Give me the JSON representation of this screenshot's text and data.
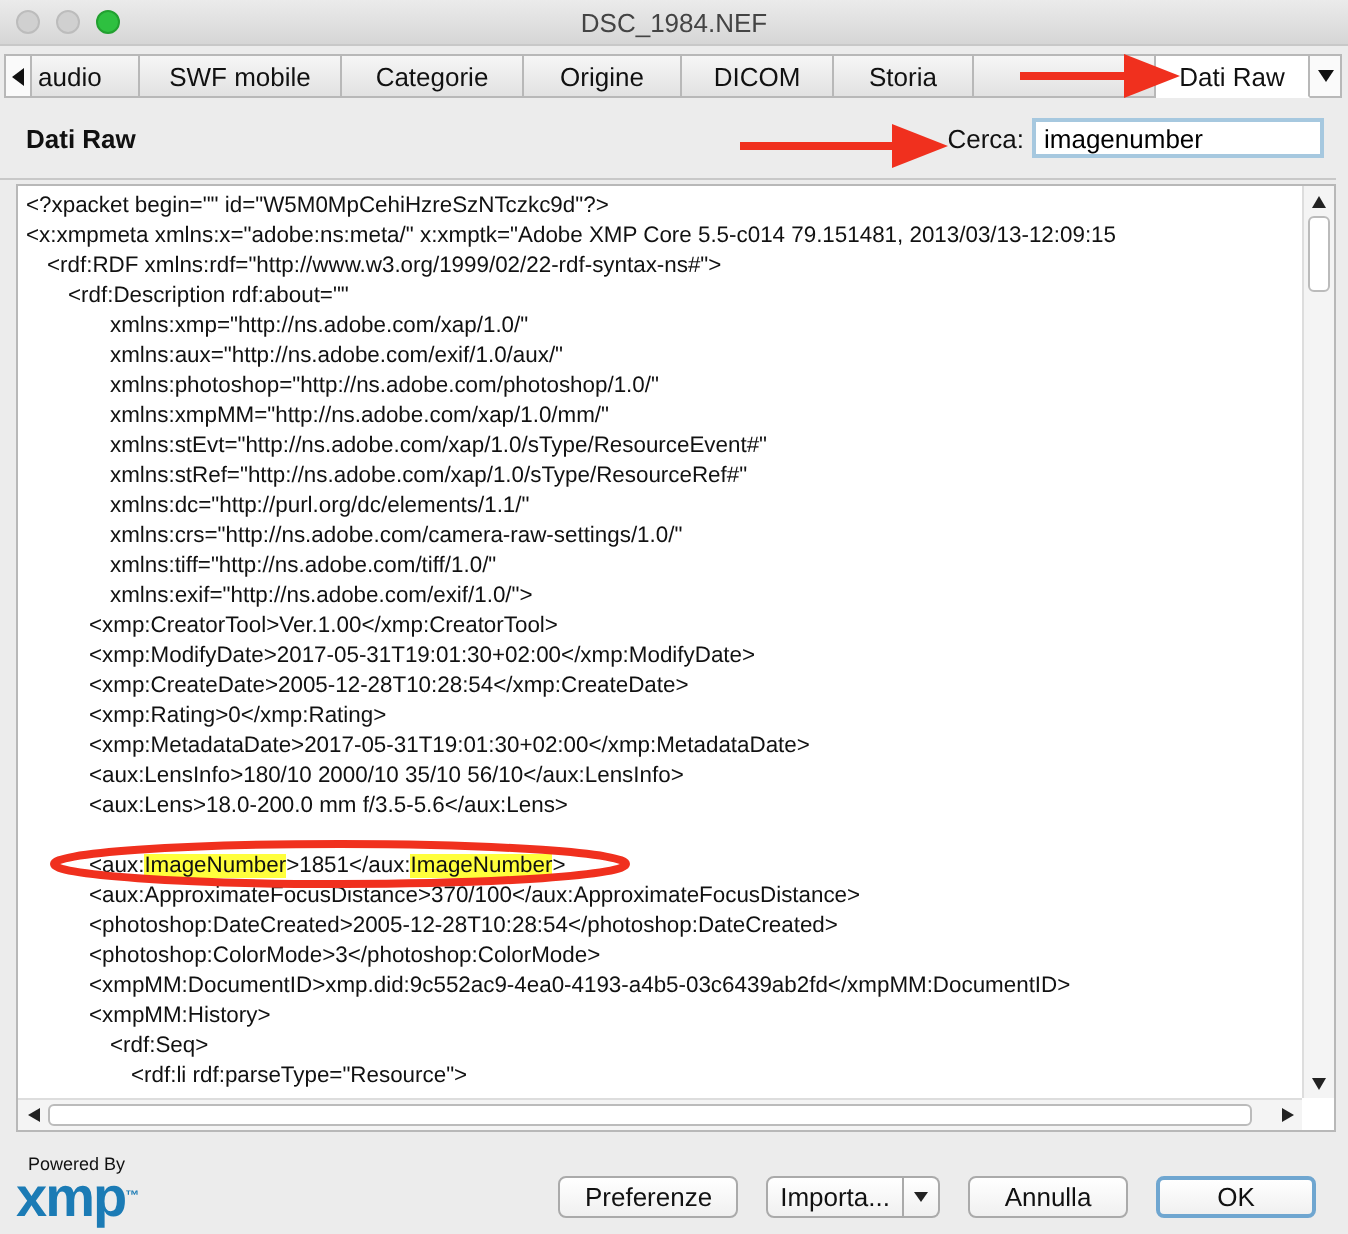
{
  "window": {
    "title": "DSC_1984.NEF"
  },
  "tabs": [
    {
      "label": "audio",
      "selected": false
    },
    {
      "label": "SWF mobile",
      "selected": false
    },
    {
      "label": "Categorie",
      "selected": false
    },
    {
      "label": "Origine",
      "selected": false
    },
    {
      "label": "DICOM",
      "selected": false
    },
    {
      "label": "Storia",
      "selected": false
    },
    {
      "selected": false
    },
    {
      "label": "Dati Raw",
      "selected": true
    }
  ],
  "panel": {
    "title": "Dati Raw",
    "search": {
      "label": "Cerca:",
      "value": "imagenumber"
    }
  },
  "xml": [
    {
      "text": "<?xpacket begin=\"\" id=\"W5M0MpCehiHzreSzNTczkc9d\"?>"
    },
    {
      "text": "<x:xmpmeta xmlns:x=\"adobe:ns:meta/\" x:xmptk=\"Adobe XMP Core 5.5-c014 79.151481, 2013/03/13-12:09:15",
      "children": [
        {
          "text": "<rdf:RDF xmlns:rdf=\"http://www.w3.org/1999/02/22-rdf-syntax-ns#\">",
          "children": [
            {
              "text": "<rdf:Description rdf:about=\"\"",
              "attributes": [
                "xmlns:xmp=\"http://ns.adobe.com/xap/1.0/\"",
                "xmlns:aux=\"http://ns.adobe.com/exif/1.0/aux/\"",
                "xmlns:photoshop=\"http://ns.adobe.com/photoshop/1.0/\"",
                "xmlns:xmpMM=\"http://ns.adobe.com/xap/1.0/mm/\"",
                "xmlns:stEvt=\"http://ns.adobe.com/xap/1.0/sType/ResourceEvent#\"",
                "xmlns:stRef=\"http://ns.adobe.com/xap/1.0/sType/ResourceRef#\"",
                "xmlns:dc=\"http://purl.org/dc/elements/1.1/\"",
                "xmlns:crs=\"http://ns.adobe.com/camera-raw-settings/1.0/\"",
                "xmlns:tiff=\"http://ns.adobe.com/tiff/1.0/\"",
                "xmlns:exif=\"http://ns.adobe.com/exif/1.0/\">"
              ],
              "children": [
                {
                  "text": "<xmp:CreatorTool>Ver.1.00</xmp:CreatorTool>"
                },
                {
                  "text": "<xmp:ModifyDate>2017-05-31T19:01:30+02:00</xmp:ModifyDate>"
                },
                {
                  "text": "<xmp:CreateDate>2005-12-28T10:28:54</xmp:CreateDate>"
                },
                {
                  "text": "<xmp:Rating>0</xmp:Rating>"
                },
                {
                  "text": "<xmp:MetadataDate>2017-05-31T19:01:30+02:00</xmp:MetadataDate>"
                },
                {
                  "text": "<aux:LensInfo>180/10 2000/10 35/10 56/10</aux:LensInfo>"
                },
                {
                  "text": "<aux:Lens>18.0-200.0 mm f/3.5-5.6</aux:Lens>"
                },
                {
                  "covered": true
                },
                {
                  "parts": [
                    {
                      "text": "<aux:",
                      "highlighted": false
                    },
                    {
                      "text": "ImageNumber",
                      "highlighted": true
                    },
                    {
                      "text": ">1851</aux:",
                      "highlighted": false
                    },
                    {
                      "text": "ImageNumber",
                      "highlighted": true
                    },
                    {
                      "text": ">",
                      "highlighted": false
                    }
                  ]
                },
                {
                  "text": "<aux:ApproximateFocusDistance>370/100</aux:ApproximateFocusDistance>"
                },
                {
                  "text": "<photoshop:DateCreated>2005-12-28T10:28:54</photoshop:DateCreated>"
                },
                {
                  "text": "<photoshop:ColorMode>3</photoshop:ColorMode>"
                },
                {
                  "text": "<xmpMM:DocumentID>xmp.did:9c552ac9-4ea0-4193-a4b5-03c6439ab2fd</xmpMM:DocumentID>"
                },
                {
                  "text": "<xmpMM:History>",
                  "children": [
                    {
                      "text": "<rdf:Seq>",
                      "children": [
                        {
                          "text": "<rdf:li rdf:parseType=\"Resource\">"
                        }
                      ]
                    }
                  ]
                }
              ]
            }
          ]
        }
      ]
    }
  ],
  "logo": {
    "caption": "Powered By",
    "mark": "xmp",
    "trademark": "™"
  },
  "buttons": [
    {
      "label": "Preferenze",
      "kind": "plain"
    },
    {
      "label": "Importa...",
      "kind": "split"
    },
    {
      "label": "Annulla",
      "kind": "plain"
    },
    {
      "label": "OK",
      "kind": "default"
    }
  ]
}
